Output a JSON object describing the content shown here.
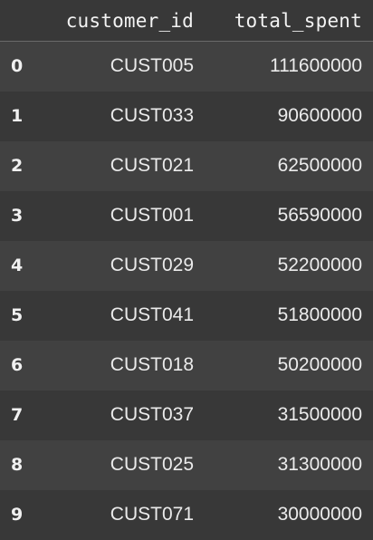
{
  "dataframe": {
    "columns": [
      "customer_id",
      "total_spent"
    ],
    "rows": [
      {
        "index": "0",
        "customer_id": "CUST005",
        "total_spent": "111600000"
      },
      {
        "index": "1",
        "customer_id": "CUST033",
        "total_spent": "90600000"
      },
      {
        "index": "2",
        "customer_id": "CUST021",
        "total_spent": "62500000"
      },
      {
        "index": "3",
        "customer_id": "CUST001",
        "total_spent": "56590000"
      },
      {
        "index": "4",
        "customer_id": "CUST029",
        "total_spent": "52200000"
      },
      {
        "index": "5",
        "customer_id": "CUST041",
        "total_spent": "51800000"
      },
      {
        "index": "6",
        "customer_id": "CUST018",
        "total_spent": "50200000"
      },
      {
        "index": "7",
        "customer_id": "CUST037",
        "total_spent": "31500000"
      },
      {
        "index": "8",
        "customer_id": "CUST025",
        "total_spent": "31300000"
      },
      {
        "index": "9",
        "customer_id": "CUST071",
        "total_spent": "30000000"
      }
    ]
  },
  "colors": {
    "background": "#383838",
    "row_stripe": "#414141",
    "text": "#e8e8e8"
  }
}
